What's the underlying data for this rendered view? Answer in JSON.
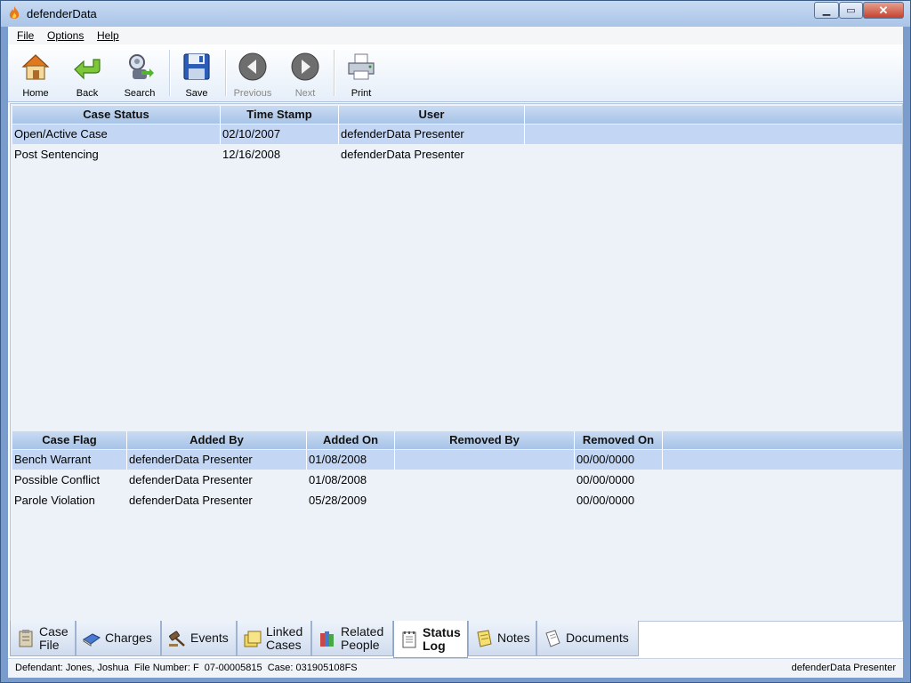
{
  "window": {
    "title": "defenderData"
  },
  "menu": [
    "File",
    "Options",
    "Help"
  ],
  "toolbar": {
    "home": "Home",
    "back": "Back",
    "search": "Search",
    "save": "Save",
    "previous": "Previous",
    "next": "Next",
    "print": "Print"
  },
  "status_grid": {
    "headers": [
      "Case Status",
      "Time Stamp",
      "User"
    ],
    "rows": [
      [
        "Open/Active Case",
        "02/10/2007",
        "defenderData Presenter"
      ],
      [
        "Post Sentencing",
        "12/16/2008",
        "defenderData Presenter"
      ]
    ]
  },
  "flag_grid": {
    "headers": [
      "Case Flag",
      "Added By",
      "Added On",
      "Removed By",
      "Removed On"
    ],
    "rows": [
      [
        "Bench Warrant",
        "defenderData Presenter",
        "01/08/2008",
        "",
        "00/00/0000"
      ],
      [
        "Possible Conflict",
        "defenderData Presenter",
        "01/08/2008",
        "",
        "00/00/0000"
      ],
      [
        "Parole Violation",
        "defenderData Presenter",
        "05/28/2009",
        "",
        "00/00/0000"
      ]
    ]
  },
  "tabs": {
    "case_file": [
      "Case",
      "File"
    ],
    "charges": "Charges",
    "events": "Events",
    "linked_cases": [
      "Linked",
      "Cases"
    ],
    "related_people": [
      "Related",
      "People"
    ],
    "status_log": [
      "Status",
      "Log"
    ],
    "notes": "Notes",
    "documents": "Documents"
  },
  "statusbar": {
    "left": "Defendant: Jones, Joshua  File Number: F  07-00005815  Case: 031905108FS",
    "right": "defenderData Presenter"
  },
  "colors": {
    "selected_row": "#c3d6f4",
    "header": "#b7cfee",
    "frame": "#7a9ccc"
  }
}
